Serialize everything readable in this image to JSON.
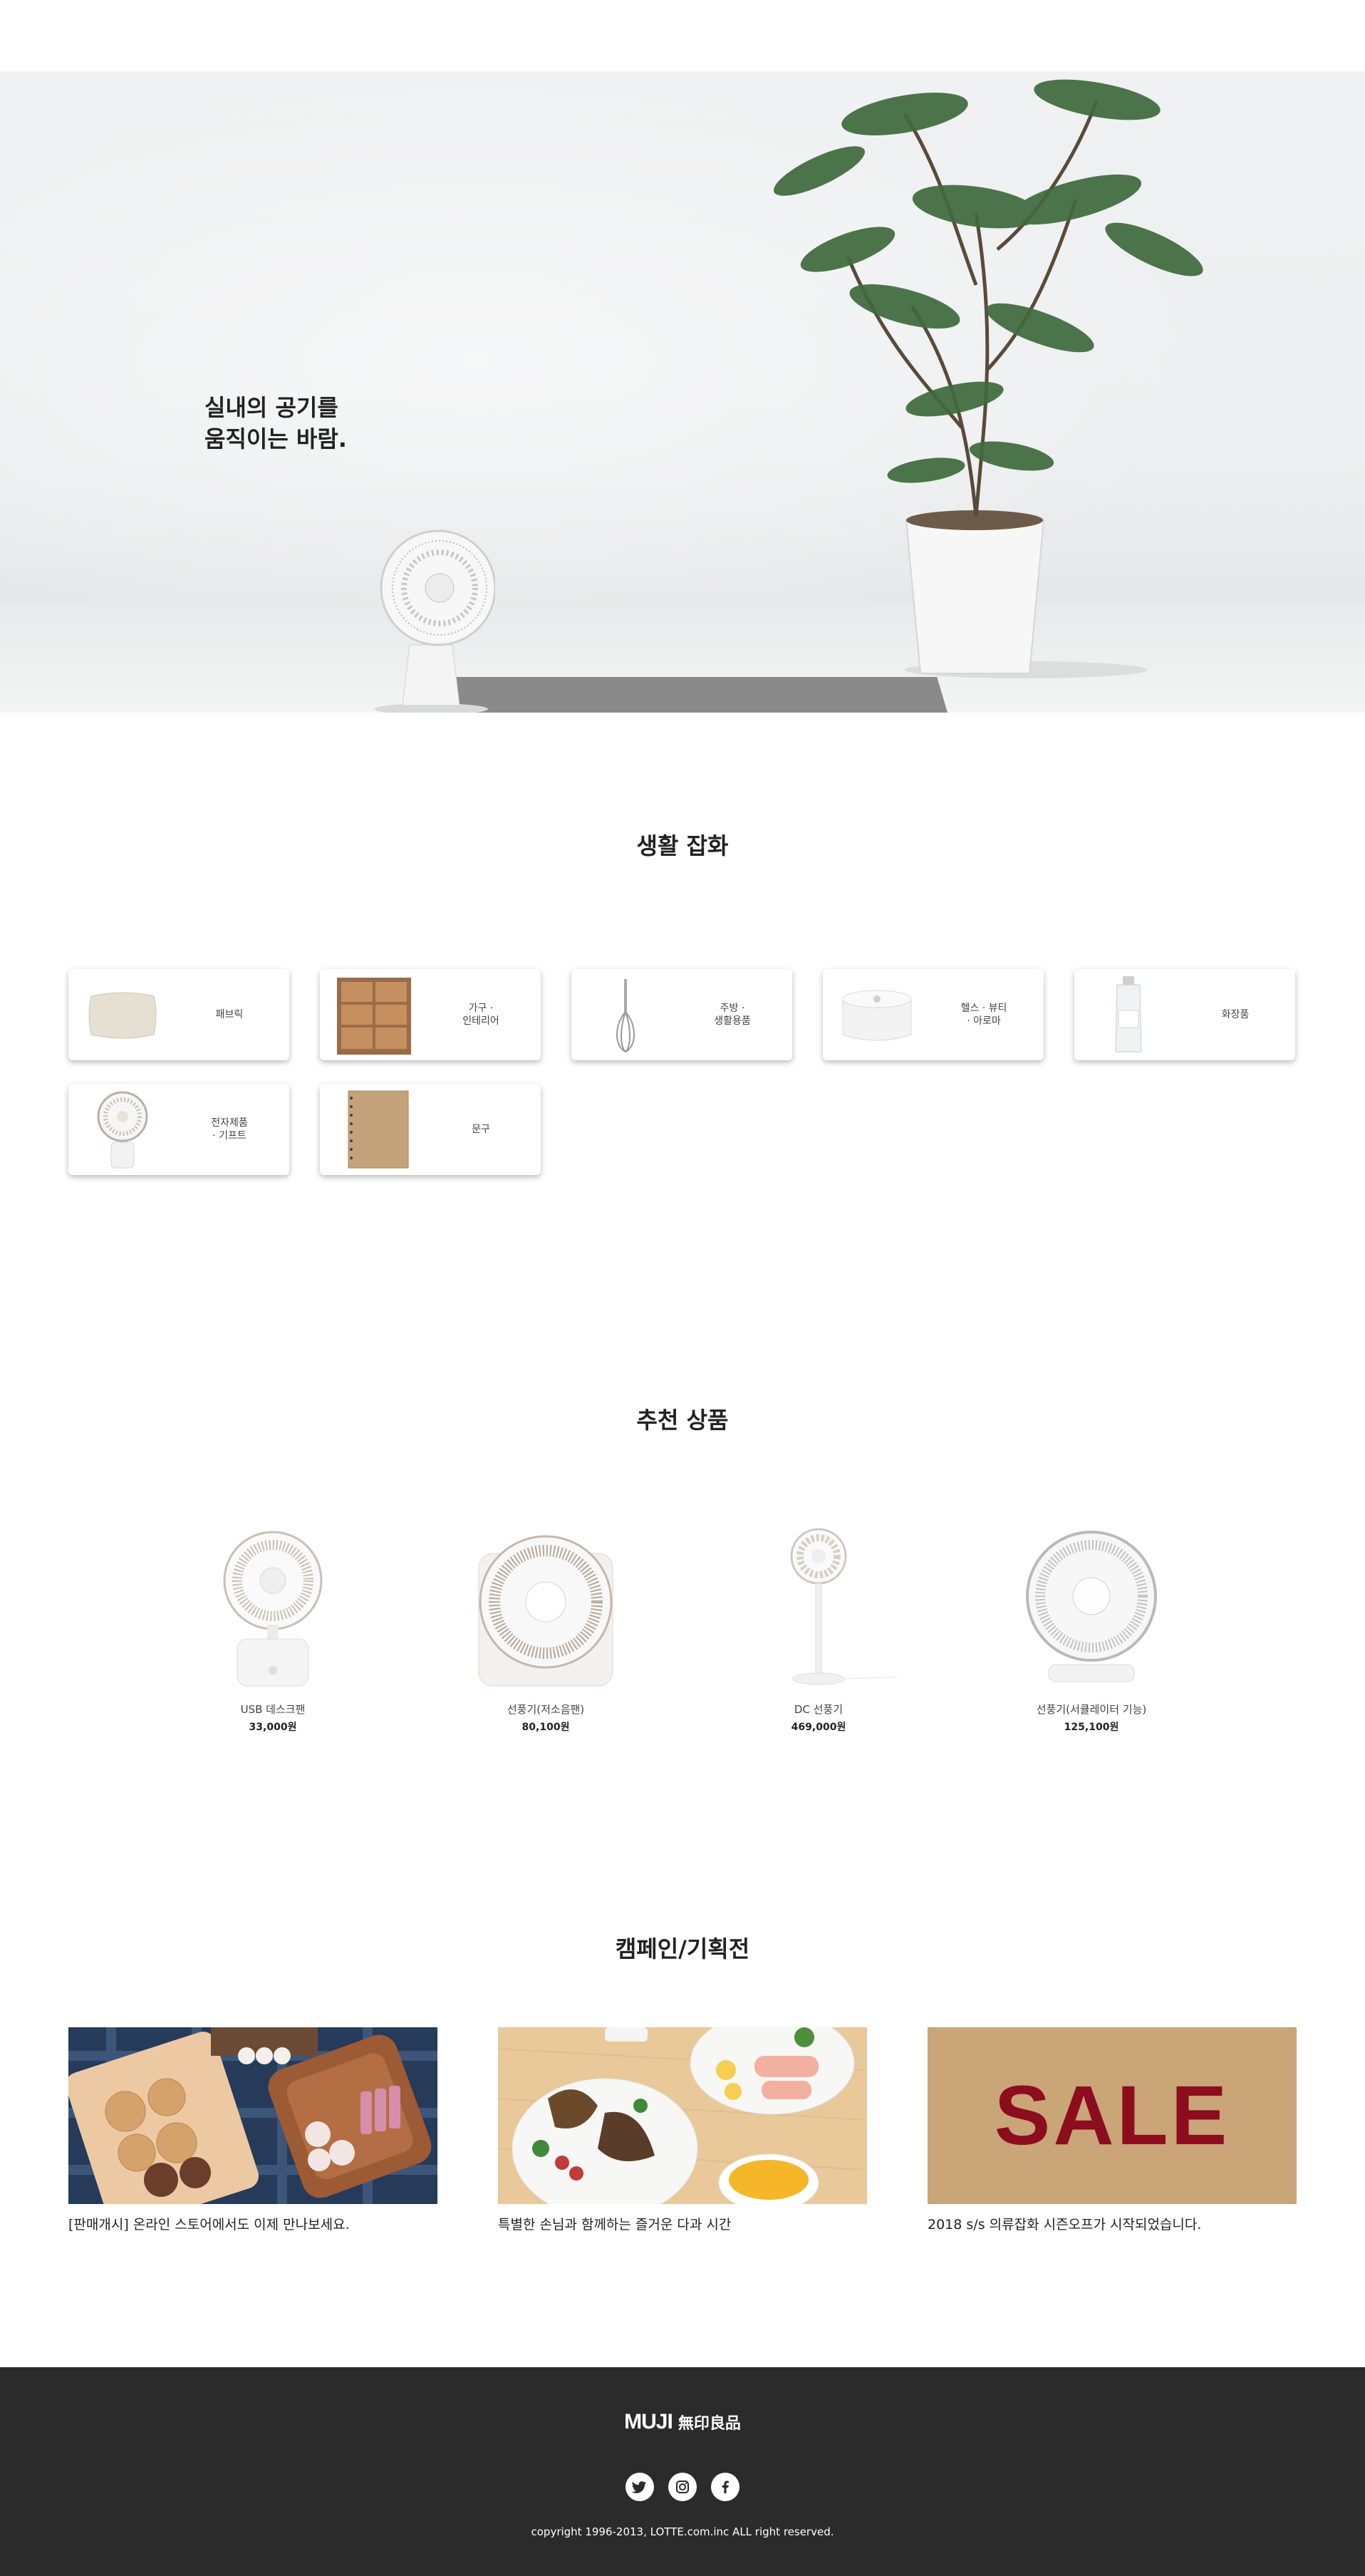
{
  "hero": {
    "headline_line1": "실내의 공기를",
    "headline_line2": "움직이는 바람."
  },
  "categories": {
    "title": "생활 잡화",
    "items": [
      {
        "label": "패브릭",
        "icon": "cushion-icon"
      },
      {
        "label": "가구 ·\n인테리어",
        "icon": "cabinet-icon"
      },
      {
        "label": "주방 ·\n생활용품",
        "icon": "whisk-icon"
      },
      {
        "label": "헬스 · 뷰티\n· 아로마",
        "icon": "diffuser-icon"
      },
      {
        "label": "화장품",
        "icon": "bottle-icon"
      },
      {
        "label": "전자제품\n· 기프트",
        "icon": "fan-icon"
      },
      {
        "label": "문구",
        "icon": "notebook-icon"
      }
    ]
  },
  "recommended": {
    "title": "추천 상품",
    "items": [
      {
        "name": "USB 데스크팬",
        "price": "33,000원"
      },
      {
        "name": "선풍기(저소음팬)",
        "price": "80,100원"
      },
      {
        "name": "DC 선풍기",
        "price": "469,000원"
      },
      {
        "name": "선풍기(서큘레이터 기능)",
        "price": "125,100원"
      }
    ]
  },
  "campaigns": {
    "title": "캠페인/기획전",
    "items": [
      {
        "text": "[판매개시] 온라인 스토어에서도 이제 만나보세요."
      },
      {
        "text": "특별한 손님과 함께하는 즐거운 다과 시간"
      },
      {
        "text": "2018 s/s 의류잡화 시즌오프가 시작되었습니다.",
        "banner": "SALE"
      }
    ]
  },
  "footer": {
    "logo_en": "MUJI",
    "logo_jp": "無印良品",
    "copyright": "copyright 1996-2013, LOTTE.com.inc ALL right reserved.",
    "social": [
      "twitter-icon",
      "instagram-icon",
      "facebook-icon"
    ]
  },
  "colors": {
    "footer_bg": "#2b2b2b",
    "sale_bg": "#c9a577",
    "sale_text": "#8b0d1e"
  }
}
